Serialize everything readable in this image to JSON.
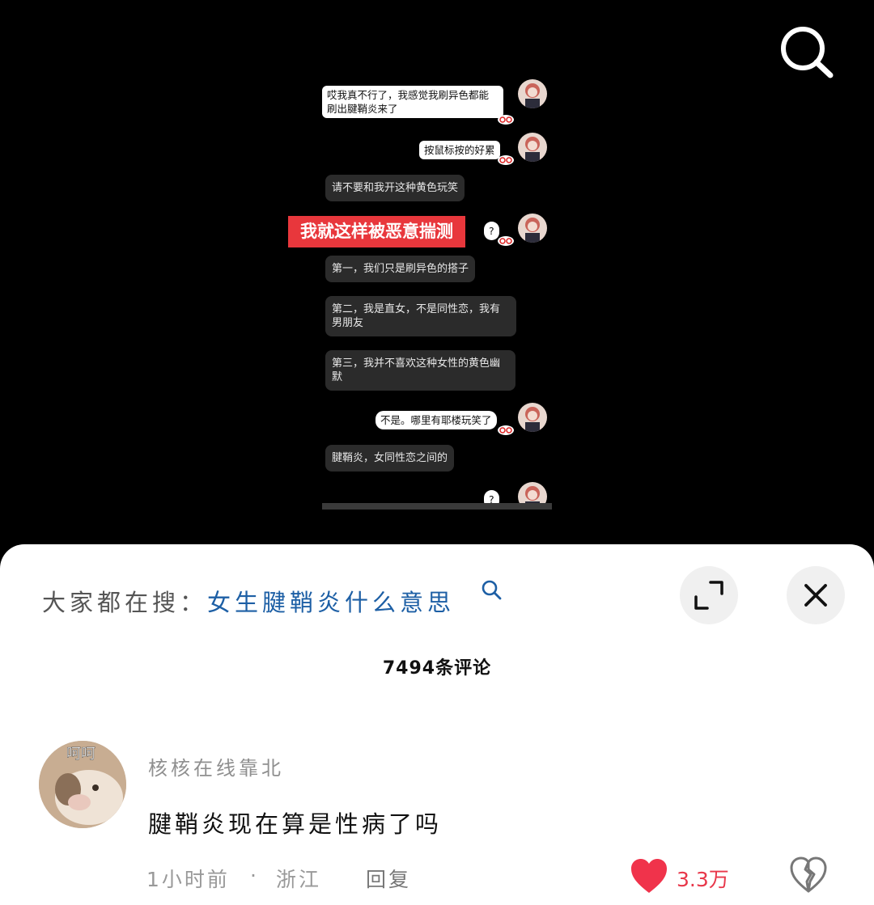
{
  "video": {
    "chat": {
      "msg1": "哎我真不行了，我感觉我刷异色都能刷出腱鞘炎来了",
      "msg2": "按鼠标按的好累",
      "msg3": "请不要和我开这种黄色玩笑",
      "overlay_caption": "我就这样被恶意揣测",
      "msg4": "?",
      "msg5": "第一，我们只是刷异色的搭子",
      "msg6": "第二，我是直女，不是同性恋，我有男朋友",
      "msg7": "第三，我并不喜欢这种女性的黄色幽默",
      "msg8": "不是。哪里有耶楼玩笑了",
      "msg9": "腱鞘炎，女同性恋之间的",
      "msg10": "?"
    }
  },
  "sheet": {
    "suggest_label": "大家都在搜：",
    "suggest_query": "女生腱鞘炎什么意思",
    "comment_count": "7494条评论"
  },
  "comment": {
    "avatar_text": "呵呵",
    "username": "核核在线靠北",
    "text": "腱鞘炎现在算是性病了吗",
    "time": "1小时前",
    "dot": "·",
    "location": "浙江",
    "reply": "回复",
    "likes": "3.3万"
  },
  "icons": {
    "search": "search-icon",
    "expand": "expand-icon",
    "close": "close-icon",
    "suggest_search": "search-icon",
    "like": "heart-icon",
    "dislike": "broken-heart-icon"
  },
  "colors": {
    "like": "#f0334b",
    "link": "#1d5fa5",
    "caption_bg": "#e8373c"
  }
}
